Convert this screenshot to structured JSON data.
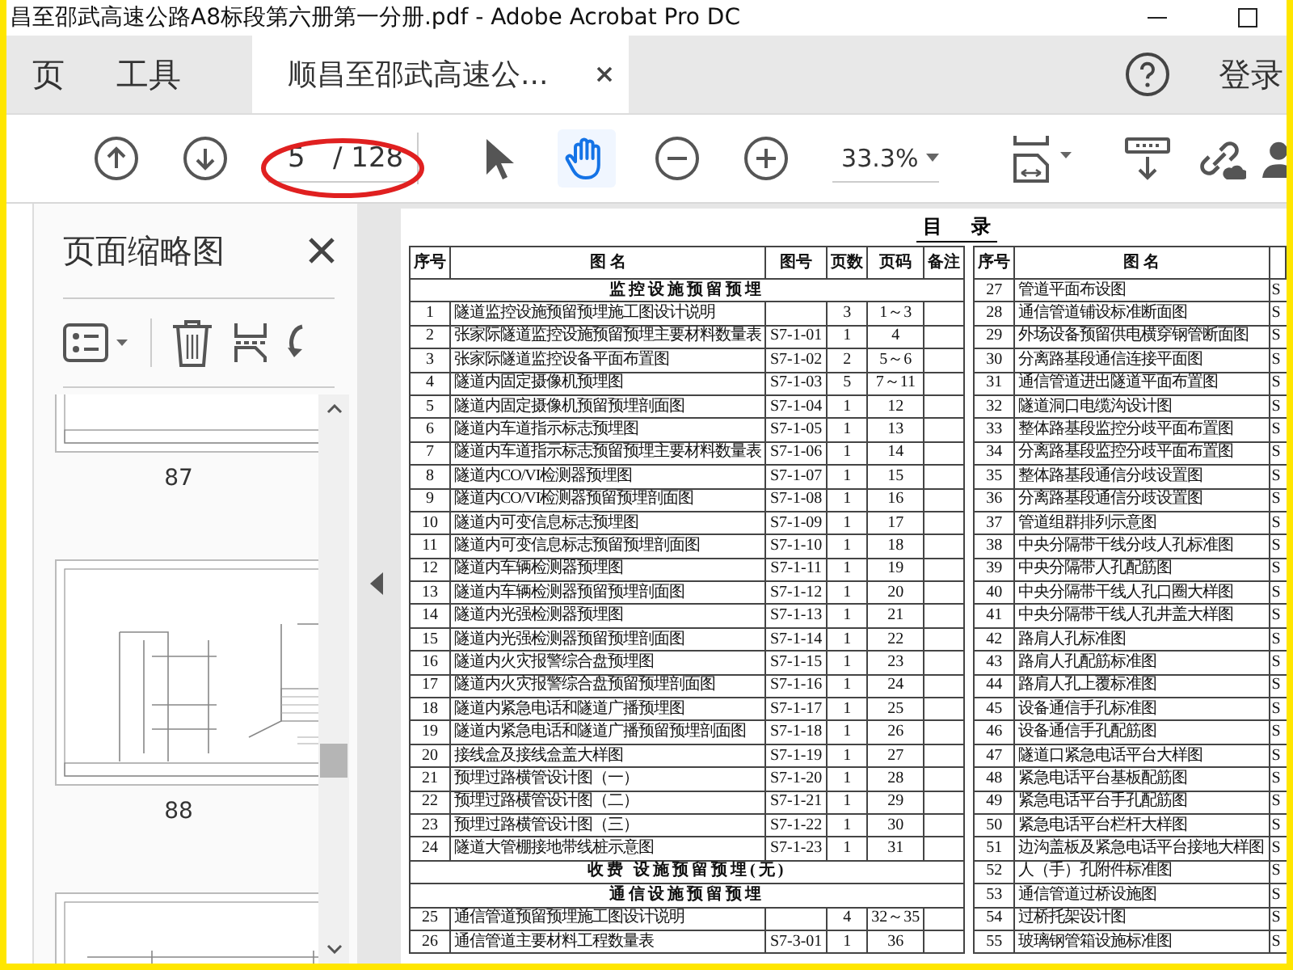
{
  "window": {
    "title": "昌至邵武高速公路A8标段第六册第一分册.pdf - Adobe Acrobat Pro DC"
  },
  "tabs": [
    {
      "label": "页",
      "kind": "nav",
      "selected": false
    },
    {
      "label": "工具",
      "kind": "nav",
      "selected": false
    },
    {
      "label": "顺昌至邵武高速公...",
      "kind": "document",
      "selected": true
    }
  ],
  "account": {
    "sign_in": "登录"
  },
  "toolbar": {
    "page_number": {
      "value": "5"
    },
    "page_count": "/ 128",
    "tools": [
      {
        "kind": "pointer",
        "selected": false
      },
      {
        "kind": "hand",
        "selected": true
      }
    ],
    "zoom": {
      "value": "33.3%"
    }
  },
  "sidebar": {
    "title": "页面缩略图",
    "thumbnails": [
      {
        "kind": "plan",
        "label": "87"
      },
      {
        "kind": "detail",
        "label": "88"
      },
      {
        "kind": "profile"
      }
    ]
  },
  "document": {
    "heading": "目      录",
    "left_table": {
      "columns": [
        "序号",
        "图 名",
        "图号",
        "页数",
        "页码",
        "备注"
      ],
      "rows": [
        {
          "kind": "section",
          "title": "监控设施预留预埋"
        },
        {
          "kind": "item",
          "no": "1",
          "name": "隧道监控设施预留预埋施工图设计说明",
          "pages": "3",
          "page_range": "1～3"
        },
        {
          "kind": "item",
          "no": "2",
          "name": "张家际隧道监控设施预留预埋主要材料数量表",
          "code": "S7-1-01",
          "pages": "1",
          "page_range": "4"
        },
        {
          "kind": "item",
          "no": "3",
          "name": "张家际隧道监控设备平面布置图",
          "code": "S7-1-02",
          "pages": "2",
          "page_range": "5～6"
        },
        {
          "kind": "item",
          "no": "4",
          "name": "隧道内固定摄像机预埋图",
          "code": "S7-1-03",
          "pages": "5",
          "page_range": "7～11"
        },
        {
          "kind": "item",
          "no": "5",
          "name": "隧道内固定摄像机预留预埋剖面图",
          "code": "S7-1-04",
          "pages": "1",
          "page_range": "12"
        },
        {
          "kind": "item",
          "no": "6",
          "name": "隧道内车道指示标志预埋图",
          "code": "S7-1-05",
          "pages": "1",
          "page_range": "13"
        },
        {
          "kind": "item",
          "no": "7",
          "name": "隧道内车道指示标志预留预埋主要材料数量表",
          "code": "S7-1-06",
          "pages": "1",
          "page_range": "14"
        },
        {
          "kind": "item",
          "no": "8",
          "name": "隧道内CO/VI检测器预埋图",
          "code": "S7-1-07",
          "pages": "1",
          "page_range": "15"
        },
        {
          "kind": "item",
          "no": "9",
          "name": "隧道内CO/VI检测器预留预埋剖面图",
          "code": "S7-1-08",
          "pages": "1",
          "page_range": "16"
        },
        {
          "kind": "item",
          "no": "10",
          "name": "隧道内可变信息标志预埋图",
          "code": "S7-1-09",
          "pages": "1",
          "page_range": "17"
        },
        {
          "kind": "item",
          "no": "11",
          "name": "隧道内可变信息标志预留预埋剖面图",
          "code": "S7-1-10",
          "pages": "1",
          "page_range": "18"
        },
        {
          "kind": "item",
          "no": "12",
          "name": "隧道内车辆检测器预埋图",
          "code": "S7-1-11",
          "pages": "1",
          "page_range": "19"
        },
        {
          "kind": "item",
          "no": "13",
          "name": "隧道内车辆检测器预留预埋剖面图",
          "code": "S7-1-12",
          "pages": "1",
          "page_range": "20"
        },
        {
          "kind": "item",
          "no": "14",
          "name": "隧道内光强检测器预埋图",
          "code": "S7-1-13",
          "pages": "1",
          "page_range": "21"
        },
        {
          "kind": "item",
          "no": "15",
          "name": "隧道内光强检测器预留预埋剖面图",
          "code": "S7-1-14",
          "pages": "1",
          "page_range": "22"
        },
        {
          "kind": "item",
          "no": "16",
          "name": "隧道内火灾报警综合盘预埋图",
          "code": "S7-1-15",
          "pages": "1",
          "page_range": "23"
        },
        {
          "kind": "item",
          "no": "17",
          "name": "隧道内火灾报警综合盘预留预埋剖面图",
          "code": "S7-1-16",
          "pages": "1",
          "page_range": "24"
        },
        {
          "kind": "item",
          "no": "18",
          "name": "隧道内紧急电话和隧道广播预埋图",
          "code": "S7-1-17",
          "pages": "1",
          "page_range": "25"
        },
        {
          "kind": "item",
          "no": "19",
          "name": "隧道内紧急电话和隧道广播预留预埋剖面图",
          "code": "S7-1-18",
          "pages": "1",
          "page_range": "26"
        },
        {
          "kind": "item",
          "no": "20",
          "name": "接线盒及接线盒盖大样图",
          "code": "S7-1-19",
          "pages": "1",
          "page_range": "27"
        },
        {
          "kind": "item",
          "no": "21",
          "name": "预埋过路横管设计图（一）",
          "code": "S7-1-20",
          "pages": "1",
          "page_range": "28"
        },
        {
          "kind": "item",
          "no": "22",
          "name": "预埋过路横管设计图（二）",
          "code": "S7-1-21",
          "pages": "1",
          "page_range": "29"
        },
        {
          "kind": "item",
          "no": "23",
          "name": "预埋过路横管设计图（三）",
          "code": "S7-1-22",
          "pages": "1",
          "page_range": "30"
        },
        {
          "kind": "item",
          "no": "24",
          "name": "隧道大管棚接地带线桩示意图",
          "code": "S7-1-23",
          "pages": "1",
          "page_range": "31"
        },
        {
          "kind": "section",
          "title": "收费 设施预留预埋(无)"
        },
        {
          "kind": "section",
          "title": "通信设施预留预埋"
        },
        {
          "kind": "item",
          "no": "25",
          "name": "通信管道预留预埋施工图设计说明",
          "pages": "4",
          "page_range": "32～35"
        },
        {
          "kind": "item",
          "no": "26",
          "name": "通信管道主要材料工程数量表",
          "code": "S7-3-01",
          "pages": "1",
          "page_range": "36"
        }
      ]
    },
    "right_table": {
      "columns": [
        "序号",
        "图 名"
      ],
      "rows": [
        {
          "no": "27",
          "name": "管道平面布设图",
          "column_3": "S"
        },
        {
          "no": "28",
          "name": "通信管道铺设标准断面图",
          "column_3": "S"
        },
        {
          "no": "29",
          "name": "外场设备预留供电横穿钢管断面图",
          "column_3": "S"
        },
        {
          "no": "30",
          "name": "分离路基段通信连接平面图",
          "column_3": "S"
        },
        {
          "no": "31",
          "name": "通信管道进出隧道平面布置图",
          "column_3": "S"
        },
        {
          "no": "32",
          "name": "隧道洞口电缆沟设计图",
          "column_3": "S"
        },
        {
          "no": "33",
          "name": "整体路基段监控分歧平面布置图",
          "column_3": "S"
        },
        {
          "no": "34",
          "name": "分离路基段监控分歧平面布置图",
          "column_3": "S"
        },
        {
          "no": "35",
          "name": "整体路基段通信分歧设置图",
          "column_3": "S"
        },
        {
          "no": "36",
          "name": "分离路基段通信分歧设置图",
          "column_3": "S"
        },
        {
          "no": "37",
          "name": "管道组群排列示意图",
          "column_3": "S"
        },
        {
          "no": "38",
          "name": "中央分隔带干线分歧人孔标准图",
          "column_3": "S"
        },
        {
          "no": "39",
          "name": "中央分隔带人孔配筋图",
          "column_3": "S"
        },
        {
          "no": "40",
          "name": "中央分隔带干线人孔口圈大样图",
          "column_3": "S"
        },
        {
          "no": "41",
          "name": "中央分隔带干线人孔井盖大样图",
          "column_3": "S"
        },
        {
          "no": "42",
          "name": "路肩人孔标准图",
          "column_3": "S"
        },
        {
          "no": "43",
          "name": "路肩人孔配筋标准图",
          "column_3": "S"
        },
        {
          "no": "44",
          "name": "路肩人孔上覆标准图",
          "column_3": "S"
        },
        {
          "no": "45",
          "name": "设备通信手孔标准图",
          "column_3": "S"
        },
        {
          "no": "46",
          "name": "设备通信手孔配筋图",
          "column_3": "S"
        },
        {
          "no": "47",
          "name": "隧道口紧急电话平台大样图",
          "column_3": "S"
        },
        {
          "no": "48",
          "name": "紧急电话平台基板配筋图",
          "column_3": "S"
        },
        {
          "no": "49",
          "name": "紧急电话平台手孔配筋图",
          "column_3": "S"
        },
        {
          "no": "50",
          "name": "紧急电话平台栏杆大样图",
          "column_3": "S"
        },
        {
          "no": "51",
          "name": "边沟盖板及紧急电话平台接地大样图",
          "column_3": "S"
        },
        {
          "no": "52",
          "name": "人（手）孔附件标准图",
          "column_3": "S"
        },
        {
          "no": "53",
          "name": "通信管道过桥设施图",
          "column_3": "S"
        },
        {
          "no": "54",
          "name": "过桥托架设计图",
          "column_3": "S"
        },
        {
          "no": "55",
          "name": "玻璃钢管箱设施标准图",
          "column_3": "S"
        }
      ]
    }
  }
}
